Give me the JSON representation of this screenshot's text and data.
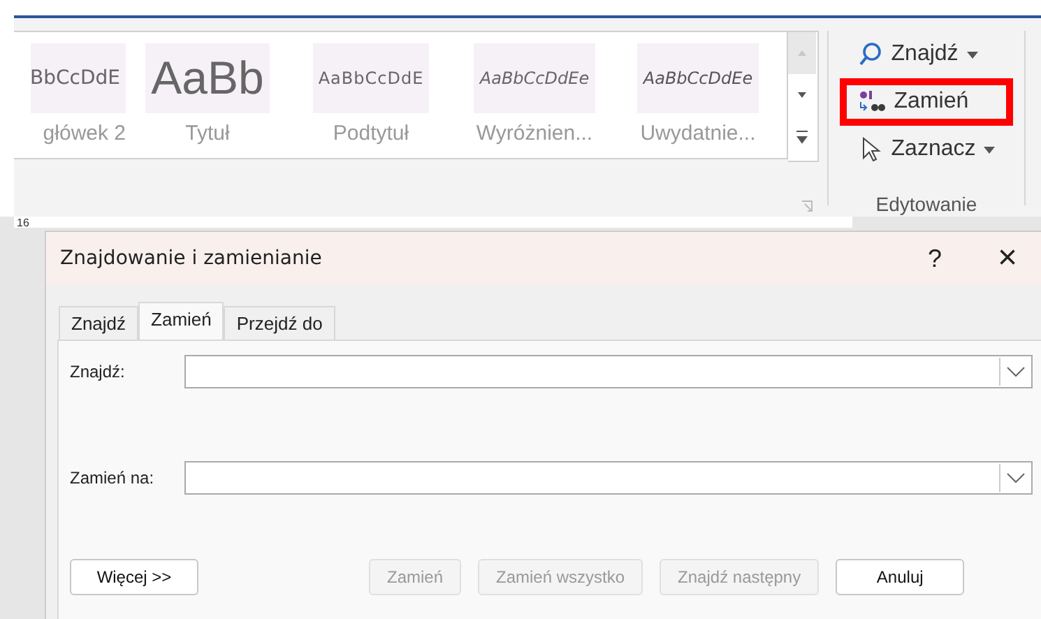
{
  "ribbon": {
    "styles": [
      {
        "kind": "heading",
        "preview": "BbCcDdE",
        "label": "główek 2"
      },
      {
        "kind": "title",
        "preview": "AaBb",
        "label": "Tytuł"
      },
      {
        "kind": "subtitle",
        "preview": "AaBbCcDdE",
        "label": "Podtytuł"
      },
      {
        "kind": "emphasis",
        "preview": "AaBbCcDdEe",
        "label": "Wyróżnien..."
      },
      {
        "kind": "intense",
        "preview": "AaBbCcDdEe",
        "label": "Uwydatnie..."
      }
    ],
    "editing": {
      "label": "Edytowanie",
      "commands": [
        {
          "kind": "find",
          "label": "Znajdź",
          "dropdown": true,
          "highlighted": false
        },
        {
          "kind": "replace",
          "label": "Zamień",
          "dropdown": false,
          "highlighted": true
        },
        {
          "kind": "select",
          "label": "Zaznacz",
          "dropdown": true,
          "highlighted": false
        }
      ]
    }
  },
  "ruler": {
    "number": "16"
  },
  "dialog": {
    "title": "Znajdowanie i zamienianie",
    "help": "?",
    "close": "×",
    "tabs": [
      {
        "label": "Znajdź",
        "selected": false
      },
      {
        "label": "Zamień",
        "selected": true
      },
      {
        "label": "Przejdź do",
        "selected": false
      }
    ],
    "fields": [
      {
        "label": "Znajdź:"
      },
      {
        "label": "Zamień na:"
      }
    ],
    "buttons": [
      {
        "label": "Więcej >>",
        "disabled": false
      },
      {
        "label": "Zamień",
        "disabled": true
      },
      {
        "label": "Zamień wszystko",
        "disabled": true
      },
      {
        "label": "Znajdź następny",
        "disabled": true
      },
      {
        "label": "Anuluj",
        "disabled": false
      }
    ]
  }
}
